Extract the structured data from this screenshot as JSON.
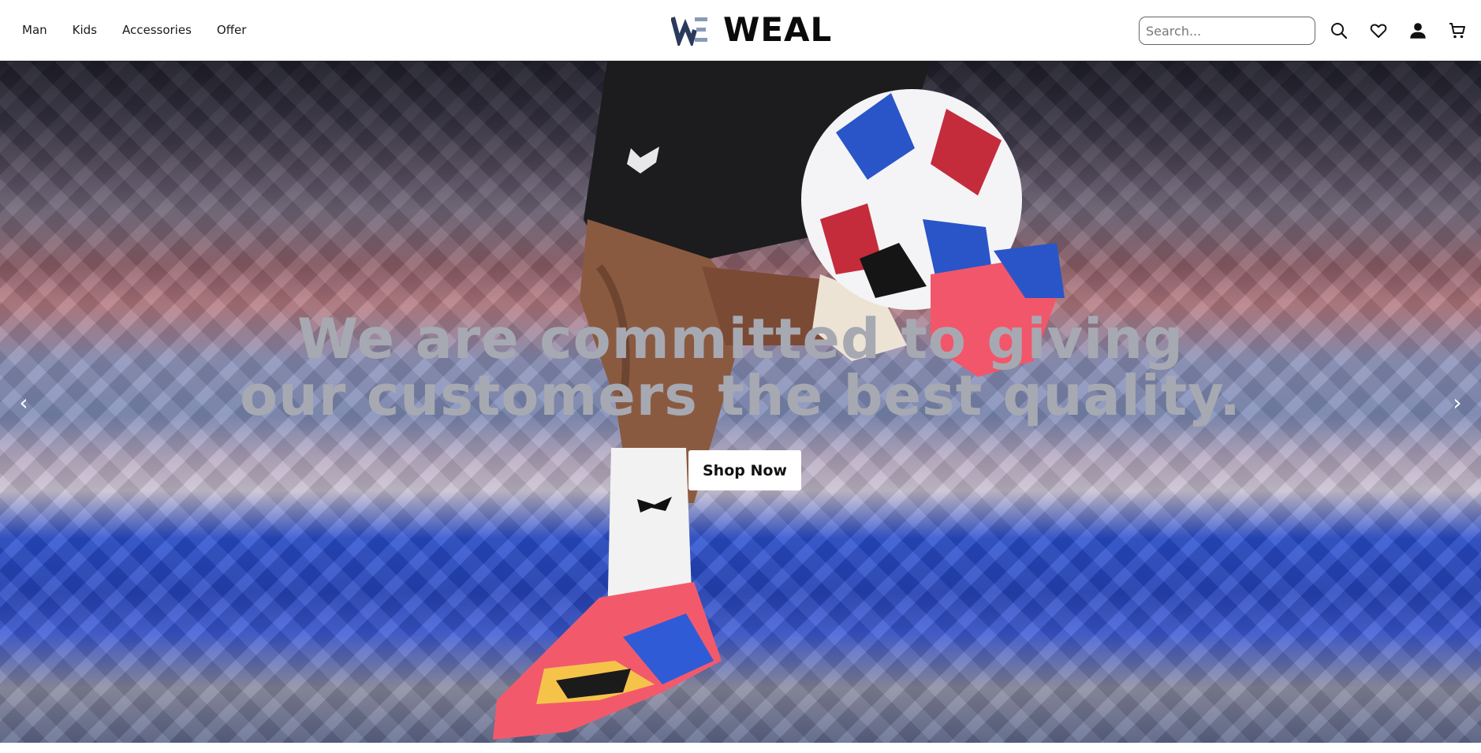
{
  "nav": {
    "items": [
      {
        "label": "Man"
      },
      {
        "label": "Kids"
      },
      {
        "label": "Accessories"
      },
      {
        "label": "Offer"
      }
    ]
  },
  "brand": {
    "name": "WEAL",
    "mark_text": "WE",
    "mark_color": "#2a3a5c",
    "mark_accent": "#8a9ab5"
  },
  "search": {
    "placeholder": "Search...",
    "value": ""
  },
  "header_icons": [
    "search-icon",
    "heart-icon",
    "user-icon",
    "cart-icon"
  ],
  "hero": {
    "headline_line1": "We are committed to giving",
    "headline_line2": "our customers the best quality.",
    "cta_label": "Shop Now",
    "prev_arrow": "‹",
    "next_arrow": "›",
    "headline_color": "#a7a9b2"
  }
}
